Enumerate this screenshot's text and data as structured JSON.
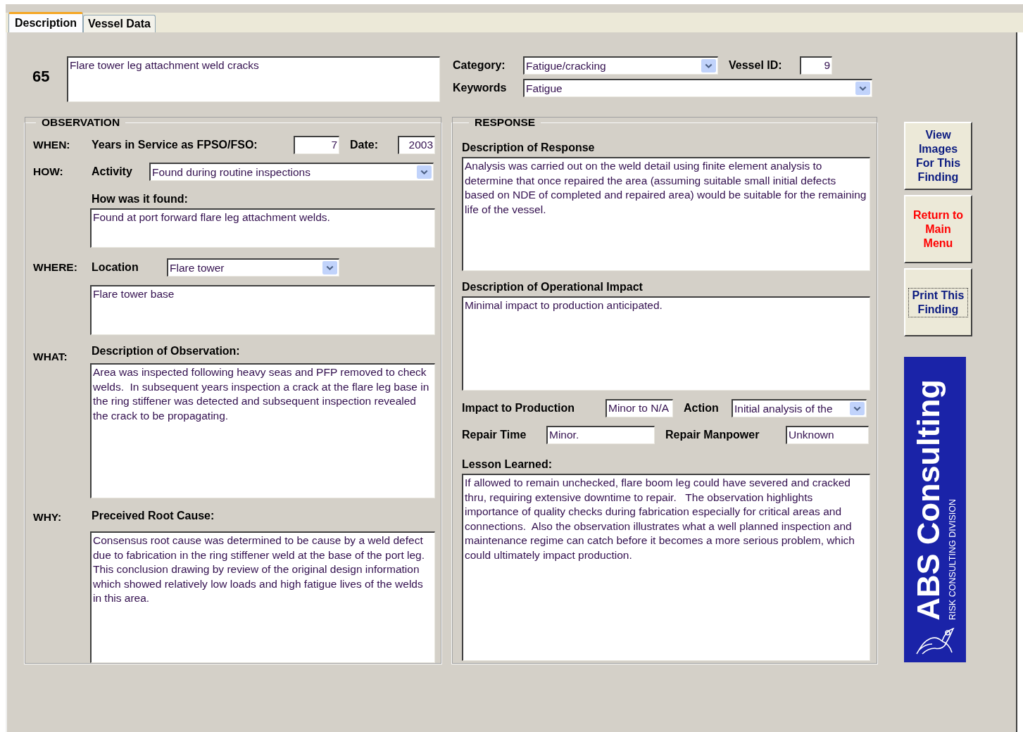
{
  "tabs": [
    {
      "label": "Description",
      "selected": true
    },
    {
      "label": "Vessel Data",
      "selected": false
    }
  ],
  "finding": {
    "number": "65",
    "title": "Flare tower leg attachment weld cracks"
  },
  "category": {
    "label": "Category:",
    "value": "Fatigue/cracking"
  },
  "vessel_id": {
    "label": "Vessel ID:",
    "value": "9"
  },
  "keywords": {
    "label": "Keywords",
    "value": "Fatigue"
  },
  "observation": {
    "title": "OBSERVATION",
    "when": {
      "label": "WHEN:",
      "years_label": "Years in Service as FPSO/FSO:",
      "years": "7",
      "date_label": "Date:",
      "date": "2003"
    },
    "how": {
      "label": "HOW:",
      "activity_label": "Activity",
      "activity": "Found during routine inspections",
      "found_label": "How was it found:",
      "found": "Found at port forward flare leg attachment welds."
    },
    "where": {
      "label": "WHERE:",
      "location_label": "Location",
      "location": "Flare tower",
      "detail": "Flare tower base"
    },
    "what": {
      "label": "WHAT:",
      "heading": "Description of Observation:",
      "text": "Area was inspected following heavy seas and PFP removed to check welds.  In subsequent years inspection a crack at the flare leg base in the ring stiffener was detected and subsequent inspection revealed the crack to be propagating."
    },
    "why": {
      "label": "WHY:",
      "heading": "Preceived Root Cause:",
      "text": "Consensus root cause was determined to be cause by a weld defect due to fabrication in the ring stiffener weld at the base of the port leg.  This conclusion drawing by review of the original design information which showed relatively low loads and high fatigue lives of the welds in this area."
    }
  },
  "response": {
    "title": "RESPONSE",
    "response_heading": "Description of Response",
    "response_text": "Analysis was carried out on the weld detail using finite element analysis to determine that once repaired the area (assuming suitable small initial defects based on NDE of completed and repaired area) would be suitable for the remaining life of the vessel.",
    "impact_heading": "Description of Operational Impact",
    "impact_text": "Minimal impact to production anticipated.",
    "production_label": "Impact to Production",
    "production": "Minor to N/A",
    "action_label": "Action",
    "action": "Initial analysis of the",
    "repair_time_label": "Repair Time",
    "repair_time": "Minor.",
    "manpower_label": "Repair Manpower",
    "manpower": "Unknown",
    "lesson_heading": "Lesson Learned:",
    "lesson_text": "If allowed to remain unchecked, flare boom leg could have severed and cracked thru, requiring extensive downtime to repair.   The observation highlights importance of quality checks during fabrication especially for critical areas and connections.  Also the observation illustrates what a well planned inspection and maintenance regime can catch before it becomes a more serious problem, which could ultimately impact production."
  },
  "buttons": [
    {
      "label": "View Images For This Finding",
      "color": "#0a1a80",
      "focused": false
    },
    {
      "label": "Return to Main Menu",
      "color": "#ff0000",
      "focused": false
    },
    {
      "label": "Print This Finding",
      "color": "#0a1a80",
      "focused": true
    }
  ],
  "logo": {
    "title": "ABS Consulting",
    "subtitle": "RISK CONSULTING DIVISION"
  }
}
